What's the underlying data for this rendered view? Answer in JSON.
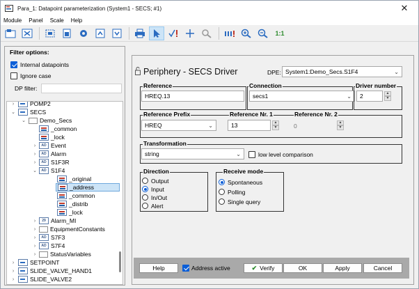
{
  "window": {
    "title": "Para_1: Datapoint parameterization (System1 - SECS; #1)",
    "close_glyph": "✕"
  },
  "menu": [
    "Module",
    "Panel",
    "Scale",
    "Help"
  ],
  "toolbar": {
    "zoom_text": "1:1"
  },
  "filter": {
    "title": "Filter options:",
    "internal_label": "Internal datapoints",
    "internal_checked": true,
    "ignore_case_label": "Ignore case",
    "ignore_case_checked": false,
    "dp_filter_label": "DP filter:",
    "dp_filter_value": ""
  },
  "tree": [
    {
      "label": "POMP2",
      "expander": "›",
      "icon": "tree"
    },
    {
      "label": "SECS",
      "expander": "⌄",
      "icon": "tree"
    },
    {
      "label": "Demo_Secs",
      "expander": "⌄",
      "icon": "folder"
    },
    {
      "label": "_common",
      "expander": "",
      "icon": "dp"
    },
    {
      "label": "_lock",
      "expander": "",
      "icon": "dp"
    },
    {
      "label": "Event",
      "expander": "›",
      "icon": "ad"
    },
    {
      "label": "Alarm",
      "expander": "›",
      "icon": "ad"
    },
    {
      "label": "S1F3R",
      "expander": "›",
      "icon": "ad"
    },
    {
      "label": "S1F4",
      "expander": "⌄",
      "icon": "ad"
    },
    {
      "label": "_original",
      "expander": "",
      "icon": "dp"
    },
    {
      "label": "_address",
      "expander": "",
      "icon": "dp",
      "selected": true
    },
    {
      "label": "_common",
      "expander": "",
      "icon": "dp"
    },
    {
      "label": "_distrib",
      "expander": "",
      "icon": "dp"
    },
    {
      "label": "_lock",
      "expander": "",
      "icon": "dp"
    },
    {
      "label": "Alarm_MI",
      "expander": "›",
      "icon": "num"
    },
    {
      "label": "EquipmentConstants",
      "expander": "›",
      "icon": "folder"
    },
    {
      "label": "S7F3",
      "expander": "›",
      "icon": "ad"
    },
    {
      "label": "S7F4",
      "expander": "›",
      "icon": "ad"
    },
    {
      "label": "StatusVariables",
      "expander": "›",
      "icon": "folder"
    },
    {
      "label": "SETPOINT",
      "expander": "›",
      "icon": "tree"
    },
    {
      "label": "SLIDE_VALVE_HAND1",
      "expander": "›",
      "icon": "tree"
    },
    {
      "label": "SLIDE_VALVE2",
      "expander": "›",
      "icon": "tree"
    }
  ],
  "tree_num_icon": "29",
  "tree_ad_icon": "AD",
  "main": {
    "title": "Periphery - SECS Driver",
    "dpe_label": "DPE:",
    "dpe_value": "System1:Demo_Secs.S1F4",
    "reference_label": "Reference",
    "reference_value": "HREQ.13",
    "connection_label": "Connection",
    "connection_value": "secs1",
    "driver_label": "Driver number",
    "driver_value": "2",
    "ref_prefix_label": "Reference Prefix",
    "ref_prefix_value": "HREQ",
    "ref_nr1_label": "Reference Nr. 1",
    "ref_nr1_value": "13",
    "ref_nr2_label": "Reference Nr. 2",
    "ref_nr2_value": "0",
    "transformation_label": "Transformation",
    "transformation_value": "string",
    "low_level_label": "low level comparison",
    "low_level_checked": false,
    "direction_label": "Direction",
    "direction_options": [
      "Output",
      "Input",
      "In/Out",
      "Alert"
    ],
    "direction_selected": "Input",
    "receive_label": "Receive mode",
    "receive_options": [
      "Spontaneous",
      "Polling",
      "Single query"
    ],
    "receive_selected": "Spontaneous"
  },
  "buttons": {
    "help": "Help",
    "address_active": "Address active",
    "address_active_checked": true,
    "verify": "Verify",
    "ok": "OK",
    "apply": "Apply",
    "cancel": "Cancel"
  }
}
